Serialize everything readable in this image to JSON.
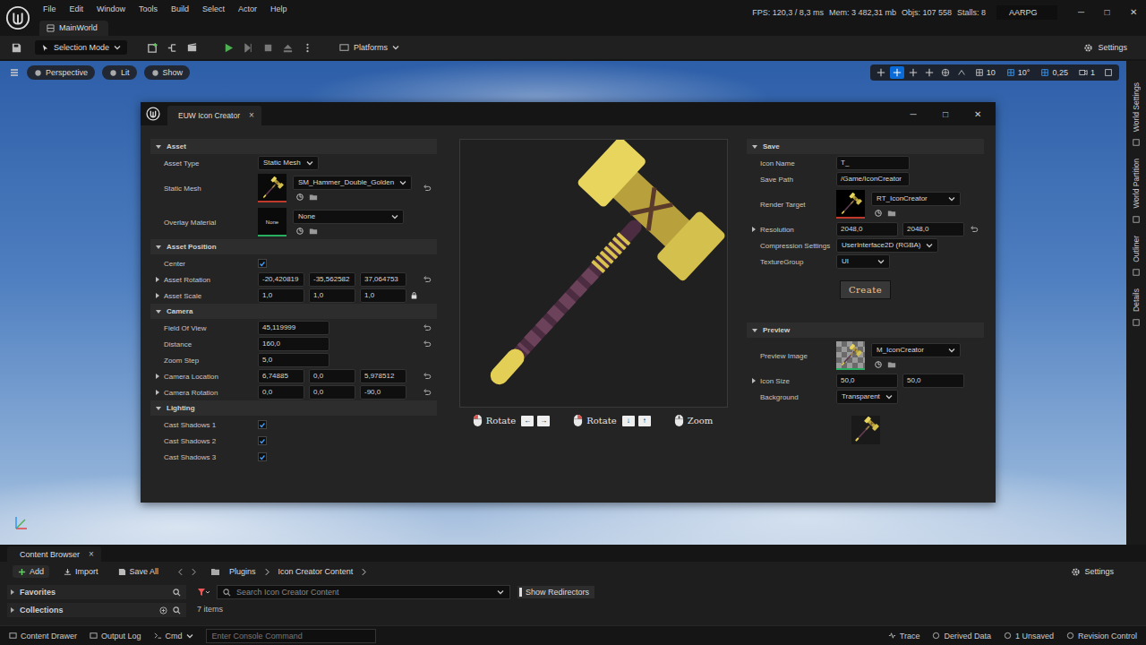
{
  "menu_bar": {
    "items": [
      "File",
      "Edit",
      "Window",
      "Tools",
      "Build",
      "Select",
      "Actor",
      "Help"
    ],
    "stats": [
      "FPS: 120,3 / 8,3 ms",
      "Mem: 3 482,31 mb",
      "Objs: 107 558",
      "Stalls: 8"
    ],
    "project": "AARPG",
    "window_controls": [
      "─",
      "□",
      "✕"
    ]
  },
  "level_tab": {
    "label": "MainWorld"
  },
  "toolbar": {
    "mode": "Selection Mode",
    "platforms": "Platforms",
    "settings": "Settings"
  },
  "viewport": {
    "view_buttons": [
      "Perspective",
      "Lit",
      "Show"
    ],
    "transform_tools": [
      {
        "selected": false
      },
      {
        "selected": true
      },
      {
        "selected": false
      },
      {
        "selected": false
      }
    ],
    "snaps": [
      {
        "value": "10",
        "on": false
      },
      {
        "value": "10°",
        "on": true
      },
      {
        "value": "0,25",
        "on": true
      }
    ],
    "camera_speed": "1",
    "side_tabs": [
      "World Settings",
      "World Partition",
      "Outliner",
      "Details"
    ]
  },
  "icon_creator": {
    "title": "EUW Icon Creator",
    "close": "×",
    "window_controls": [
      "─",
      "□",
      "✕"
    ],
    "sections": [
      {
        "title": "Asset",
        "expanded": true,
        "rows": [
          {
            "label": "Asset Type",
            "kind": "dropdown",
            "value": "Static Mesh",
            "expandable": false,
            "resettable": false
          },
          {
            "label": "Static Mesh",
            "kind": "mesh-asset",
            "value": "SM_Hammer_Double_Golden",
            "expandable": false,
            "resettable": true
          },
          {
            "label": "Overlay Material",
            "kind": "empty-asset",
            "value": "None",
            "thumbnail_label": "None",
            "expandable": false,
            "resettable": false
          }
        ]
      },
      {
        "title": "Asset Position",
        "expanded": true,
        "rows": [
          {
            "label": "Center",
            "kind": "checkbox",
            "checked": true,
            "expandable": false,
            "resettable": false
          },
          {
            "label": "Asset Rotation",
            "kind": "vector",
            "values": [
              "-20,420819",
              "-35,562582",
              "37,064753"
            ],
            "expandable": true,
            "expanded": false,
            "resettable": true,
            "locked": false
          },
          {
            "label": "Asset Scale",
            "kind": "vector",
            "values": [
              "1,0",
              "1,0",
              "1,0"
            ],
            "expandable": true,
            "expanded": false,
            "resettable": false,
            "locked": true
          }
        ]
      },
      {
        "title": "Camera",
        "expanded": true,
        "rows": [
          {
            "label": "Field Of View",
            "kind": "number",
            "value": "45,119999",
            "expandable": false,
            "resettable": true
          },
          {
            "label": "Distance",
            "kind": "number",
            "value": "160,0",
            "expandable": false,
            "resettable": true
          },
          {
            "label": "Zoom Step",
            "kind": "number",
            "value": "5,0",
            "expandable": false,
            "resettable": false
          },
          {
            "label": "Camera Location",
            "kind": "vector",
            "values": [
              "6,74885",
              "0,0",
              "5,978512"
            ],
            "expandable": true,
            "expanded": false,
            "resettable": true,
            "locked": false
          },
          {
            "label": "Camera Rotation",
            "kind": "vector",
            "values": [
              "0,0",
              "0,0",
              "-90,0"
            ],
            "expandable": true,
            "expanded": false,
            "resettable": true,
            "locked": false
          }
        ]
      },
      {
        "title": "Lighting",
        "expanded": true,
        "rows": [
          {
            "label": "Cast Shadows 1",
            "kind": "checkbox",
            "checked": true,
            "expandable": false,
            "resettable": false
          },
          {
            "label": "Cast Shadows 2",
            "kind": "checkbox",
            "checked": true,
            "expandable": false,
            "resettable": false
          },
          {
            "label": "Cast Shadows 3",
            "kind": "checkbox",
            "checked": true,
            "expandable": false,
            "resettable": false
          }
        ]
      }
    ],
    "preview_controls": [
      {
        "label": "Rotate",
        "mouse_button": "left",
        "keys": [
          "←",
          "→"
        ]
      },
      {
        "label": "Rotate",
        "mouse_button": "right",
        "keys": [
          "↓",
          "↑"
        ]
      },
      {
        "label": "Zoom",
        "mouse_button": "wheel",
        "keys": []
      }
    ],
    "save_section": {
      "title": "Save",
      "expanded": true,
      "rows": [
        {
          "label": "Icon Name",
          "kind": "number",
          "value": "T_",
          "expandable": false,
          "resettable": false
        },
        {
          "label": "Save Path",
          "kind": "number",
          "value": "/Game/IconCreator",
          "expandable": false,
          "resettable": false
        },
        {
          "label": "Render Target",
          "kind": "texture-asset",
          "value": "RT_IconCreator",
          "expandable": false,
          "resettable": false
        },
        {
          "label": "Resolution",
          "kind": "vector",
          "values": [
            "2048,0",
            "2048,0"
          ],
          "expandable": true,
          "expanded": false,
          "resettable": true,
          "locked": false
        },
        {
          "label": "Compression Settings",
          "kind": "dropdown",
          "value": "UserInterface2D (RGBA)",
          "expandable": false,
          "resettable": false
        },
        {
          "label": "TextureGroup",
          "kind": "dropdown",
          "value": "UI",
          "expandable": false,
          "resettable": false
        }
      ]
    },
    "create_button": "Create",
    "preview_section": {
      "title": "Preview",
      "expanded": true,
      "rows": [
        {
          "label": "Preview Image",
          "kind": "material-asset",
          "value": "M_IconCreator",
          "expandable": false,
          "resettable": false
        },
        {
          "label": "Icon Size",
          "kind": "vector",
          "values": [
            "50,0",
            "50,0"
          ],
          "expandable": true,
          "expanded": false,
          "resettable": false,
          "locked": false
        },
        {
          "label": "Background",
          "kind": "dropdown",
          "value": "Transparent",
          "expandable": false,
          "resettable": false
        }
      ]
    }
  },
  "content_browser": {
    "tab": "Content Browser",
    "close": "×",
    "buttons": [
      "Add",
      "Import",
      "Save All"
    ],
    "path": [
      "Plugins",
      "Icon Creator Content"
    ],
    "settings": "Settings",
    "sidebar": [
      {
        "label": "Favorites",
        "expanded": false
      },
      {
        "label": "Collections",
        "expanded": false
      }
    ],
    "search_placeholder": "Search Icon Creator Content",
    "show_redirectors": "Show Redirectors",
    "count": "7 items"
  },
  "status_bar": {
    "left": [
      "Content Drawer",
      "Output Log"
    ],
    "cmd": "Cmd",
    "console_placeholder": "Enter Console Command",
    "right": [
      "Trace",
      "Derived Data",
      "1 Unsaved",
      "Revision Control"
    ]
  }
}
